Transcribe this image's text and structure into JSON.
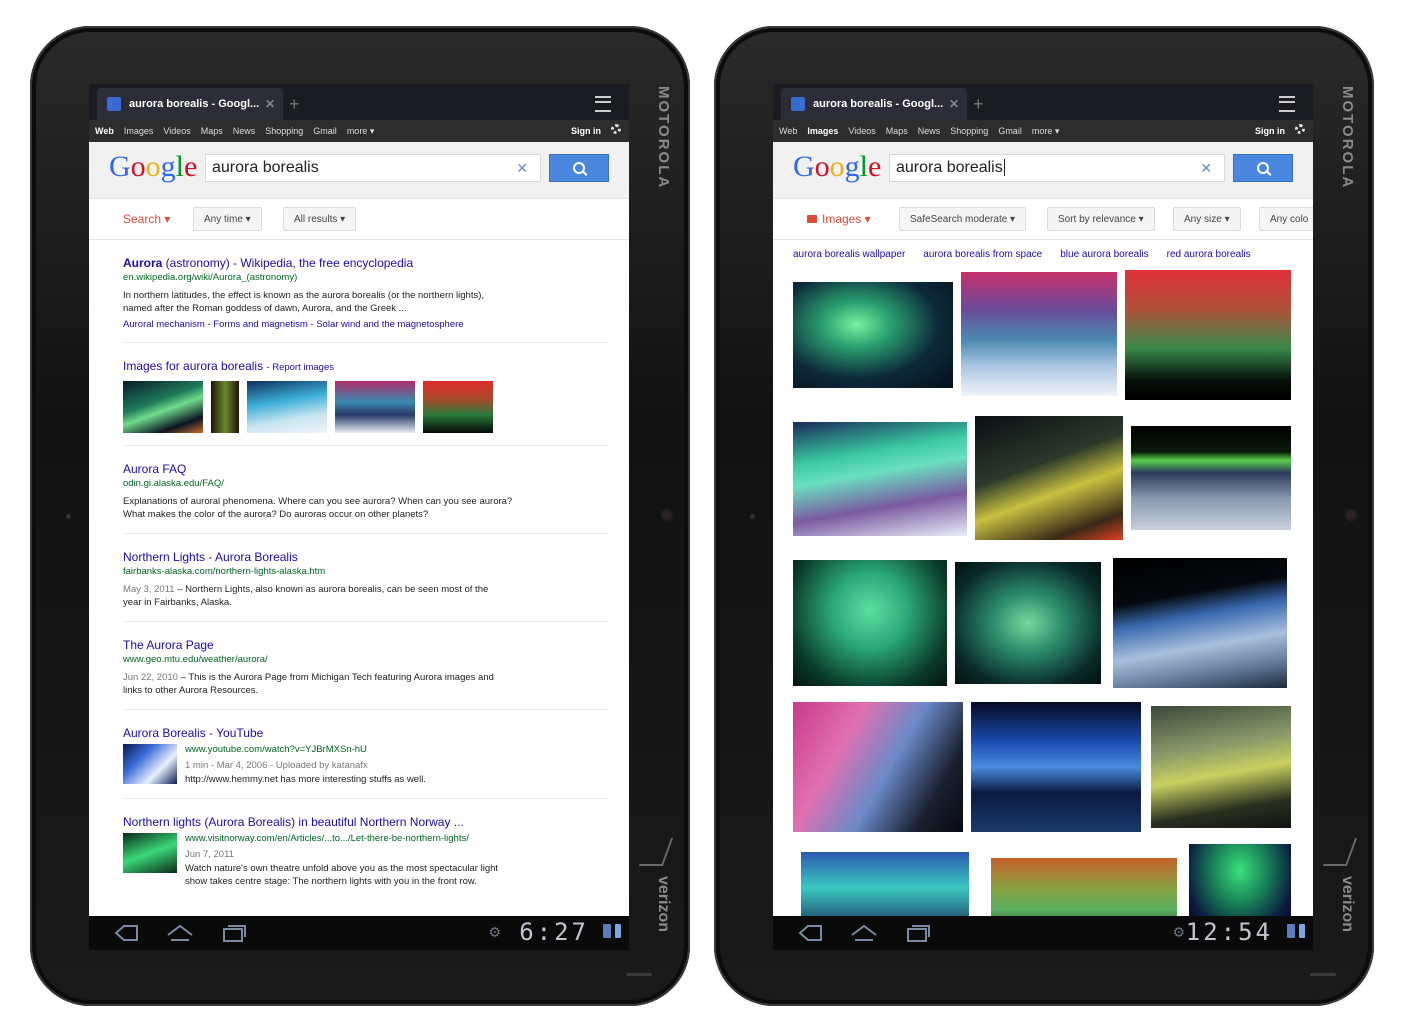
{
  "left": {
    "tab_title": "aurora borealis - Googl...",
    "gbar": [
      "Web",
      "Images",
      "Videos",
      "Maps",
      "News",
      "Shopping",
      "Gmail",
      "more ▾"
    ],
    "active_gbar": "Web",
    "signin": "Sign in",
    "logo": "Google",
    "query": "aurora borealis",
    "tools": [
      "Search ▾",
      "Any time ▾",
      "All results ▾"
    ],
    "results": [
      {
        "title_a": "Aurora",
        "title_b": " (astronomy) - Wikipedia, the free encyclopedia",
        "url": "en.wikipedia.org/wiki/Aurora_(astronomy)",
        "snippet_1": "In northern latitudes, the effect is known as the aurora borealis (or the northern lights),",
        "snippet_2": "named after the Roman goddess of dawn, Aurora, and the Greek ...",
        "links": "Auroral mechanism - Forms and magnetism - Solar wind and the magnetosphere"
      },
      {
        "title": "Images for aurora borealis",
        "report": "- Report images"
      },
      {
        "title": "Aurora FAQ",
        "url": "odin.gi.alaska.edu/FAQ/",
        "snippet_1": "Explanations of auroral phenomena. Where can you see aurora? When can you see aurora?",
        "snippet_2": "What makes the color of the aurora? Do auroras occur on other planets?"
      },
      {
        "title": "Northern Lights - Aurora Borealis",
        "url": "fairbanks-alaska.com/northern-lights-alaska.htm",
        "date": "May 3, 2011",
        "snippet_1": " – Northern Lights, also known as aurora borealis, can be seen most of the",
        "snippet_2": "year in Fairbanks, Alaska."
      },
      {
        "title": "The Aurora Page",
        "url": "www.geo.mtu.edu/weather/aurora/",
        "date": "Jun 22, 2010",
        "snippet_1": " – This is the Aurora Page from Michigan Tech featuring Aurora images and",
        "snippet_2": "links to other Aurora Resources."
      },
      {
        "title": "Aurora Borealis - YouTube",
        "url": "www.youtube.com/watch?v=YJBrMXSn-hU",
        "meta": "1 min - Mar 4, 2006 - Uploaded by katanafx",
        "snippet": "http://www.hemmy.net has more interesting stuffs as well."
      },
      {
        "title": "Northern lights (Aurora Borealis) in beautiful Northern Norway ...",
        "url": "www.visitnorway.com/en/Articles/...to.../Let-there-be-northern-lights/",
        "date": "Jun 7, 2011",
        "snippet_1": "Watch nature's own theatre unfold above you as the most spectacular light",
        "snippet_2": "show takes centre stage: The northern lights with you in the front row."
      }
    ],
    "clock": "6:27"
  },
  "right": {
    "tab_title": "aurora borealis - Googl...",
    "gbar": [
      "Web",
      "Images",
      "Videos",
      "Maps",
      "News",
      "Shopping",
      "Gmail",
      "more ▾"
    ],
    "active_gbar": "Images",
    "signin": "Sign in",
    "logo": "Google",
    "query": "aurora borealis",
    "tools": [
      "Images ▾",
      "SafeSearch moderate ▾",
      "Sort by relevance ▾",
      "Any size ▾",
      "Any colo"
    ],
    "related": [
      "aurora borealis wallpaper",
      "aurora borealis from space",
      "blue aurora borealis",
      "red aurora borealis"
    ],
    "clock": "12:54"
  },
  "device": {
    "brand": "MOTOROLA",
    "carrier": "verizon"
  },
  "colors": {
    "accent": "#4a88e0",
    "link": "#1a0dab",
    "url": "#006621",
    "tool_red": "#dd4b39"
  }
}
